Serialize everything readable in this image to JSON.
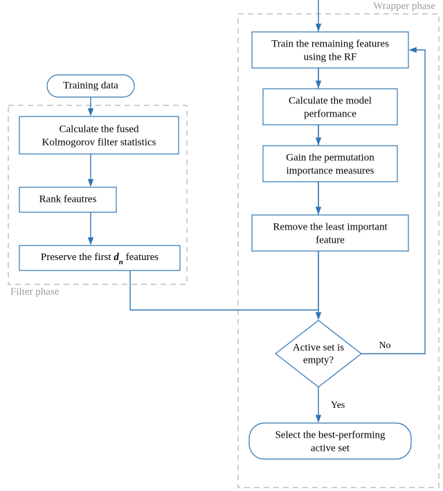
{
  "phases": {
    "filter": {
      "label": "Filter phase"
    },
    "wrapper": {
      "label": "Wrapper phase"
    }
  },
  "left": {
    "start": "Training data",
    "step1_l1": "Calculate the fused",
    "step1_l2": "Kolmogorov filter statistics",
    "step2": "Rank feautres",
    "step3_pre": "Preserve the first ",
    "step3_var": "d",
    "step3_sub": "n",
    "step3_post": " features"
  },
  "right": {
    "step1_l1": "Train the remaining features",
    "step1_l2": "using the RF",
    "step2_l1": "Calculate the model",
    "step2_l2": "performance",
    "step3_l1": "Gain the permutation",
    "step3_l2": "importance measures",
    "step4_l1": "Remove the least important",
    "step4_l2": "feature",
    "decision_l1": "Active set is",
    "decision_l2": "empty?",
    "yes": "Yes",
    "no": "No",
    "result_l1": "Select the best-performing",
    "result_l2": "active set"
  }
}
